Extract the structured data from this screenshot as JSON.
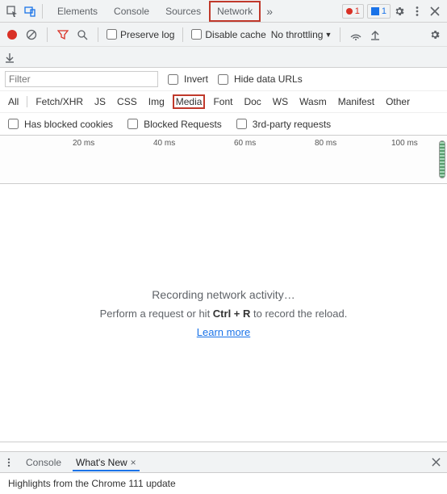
{
  "topbar": {
    "tabs": [
      "Elements",
      "Console",
      "Sources",
      "Network"
    ],
    "active_tab": "Network",
    "error_count": "1",
    "message_count": "1"
  },
  "toolbar": {
    "preserve_log_label": "Preserve log",
    "disable_cache_label": "Disable cache",
    "throttling_label": "No throttling"
  },
  "filter": {
    "placeholder": "Filter",
    "invert_label": "Invert",
    "hide_data_urls_label": "Hide data URLs"
  },
  "types": {
    "all": "All",
    "fetch": "Fetch/XHR",
    "js": "JS",
    "css": "CSS",
    "img": "Img",
    "media": "Media",
    "font": "Font",
    "doc": "Doc",
    "ws": "WS",
    "wasm": "Wasm",
    "manifest": "Manifest",
    "other": "Other"
  },
  "blocked": {
    "has_blocked_cookies": "Has blocked cookies",
    "blocked_requests": "Blocked Requests",
    "third_party": "3rd-party requests"
  },
  "timeline": {
    "ticks": [
      "20 ms",
      "40 ms",
      "60 ms",
      "80 ms",
      "100 ms"
    ]
  },
  "main": {
    "recording": "Recording network activity…",
    "hint_before": "Perform a request or hit ",
    "hint_key": "Ctrl + R",
    "hint_after": " to record the reload.",
    "learn_more": "Learn more"
  },
  "drawer": {
    "console_tab": "Console",
    "whatsnew_tab": "What's New",
    "body": "Highlights from the Chrome 111 update"
  }
}
